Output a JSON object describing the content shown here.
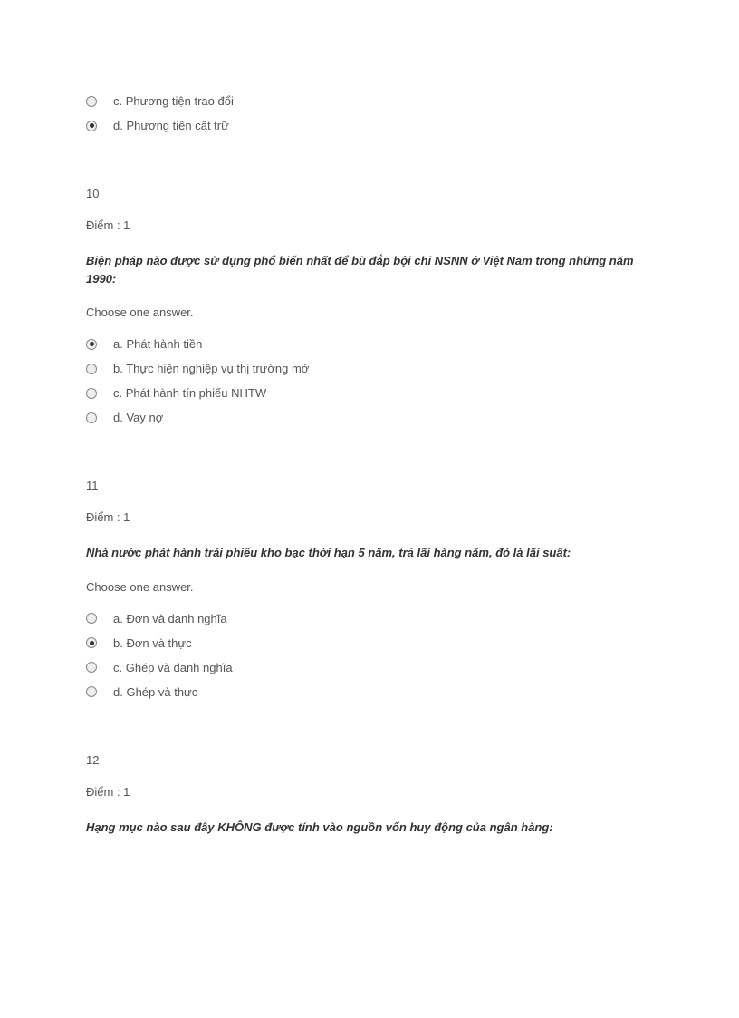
{
  "partialQuestion": {
    "options": [
      {
        "label": "c. Phương tiện trao đổi",
        "selected": false
      },
      {
        "label": "d. Phương tiện cất trữ",
        "selected": true
      }
    ]
  },
  "questions": [
    {
      "number": "10",
      "points": "Điểm : 1",
      "text": "Biện pháp nào được sử dụng phổ biến nhất để bù đắp bội chi NSNN ở Việt Nam trong những năm 1990:",
      "choose": "Choose one answer.",
      "options": [
        {
          "label": "a. Phát hành tiền",
          "selected": true
        },
        {
          "label": "b. Thực hiện nghiệp vụ thị trường mở",
          "selected": false
        },
        {
          "label": "c. Phát hành tín phiếu NHTW",
          "selected": false
        },
        {
          "label": "d. Vay nợ",
          "selected": false
        }
      ]
    },
    {
      "number": "11",
      "points": "Điểm : 1",
      "text": "Nhà nước phát hành trái phiếu kho bạc thời hạn 5 năm, trả lãi hàng năm, đó là lãi suất:",
      "choose": "Choose one answer.",
      "options": [
        {
          "label": "a. Đơn và danh nghĩa",
          "selected": false
        },
        {
          "label": "b. Đơn và thực",
          "selected": true
        },
        {
          "label": "c. Ghép và danh nghĩa",
          "selected": false
        },
        {
          "label": "d. Ghép và thực",
          "selected": false
        }
      ]
    },
    {
      "number": "12",
      "points": "Điểm : 1",
      "text": "Hạng mục nào sau đây KHÔNG được tính vào nguồn vốn huy động của ngân hàng:",
      "choose": "",
      "options": []
    }
  ]
}
